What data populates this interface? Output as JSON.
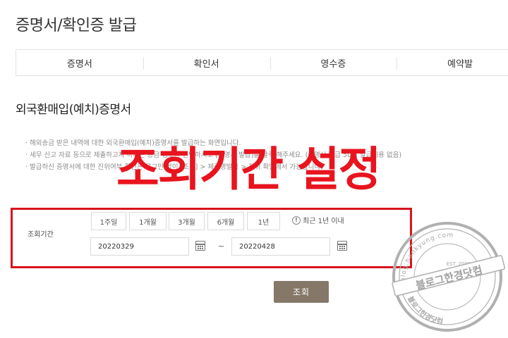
{
  "page_title": "증명서/확인증 발급",
  "tabs": [
    {
      "label": "증명서"
    },
    {
      "label": "확인서"
    },
    {
      "label": "영수증"
    },
    {
      "label": "예약발"
    }
  ],
  "section_title": "외국환매입(예치)증명서",
  "notes": [
    "· 해외송금 받은 내역에 대한 외국환매입(예치)증명서를 발급하는 화면입니다.",
    "· 세무 신고 자료 등으로 제출하고자 하시는 송금 정보를 선택하시고 [증명서 발급]을 클릭 해주세요. (증명서 발급 50매 발급비용 없음)",
    "· 발급하신 증명서에 대한 진위여부 확인은 로그인 없이 [조회] > 제증명발급 > 진위 확인에서 가능합니다."
  ],
  "overlay_caption": "조회기간 설정",
  "search_period": {
    "label": "조회기간",
    "buttons": [
      "1주일",
      "1개월",
      "3개월",
      "6개월",
      "1년"
    ],
    "note": "최근 1년 이내",
    "from": "20220329",
    "to": "20220428",
    "separator": "~"
  },
  "search_button": "조회",
  "watermark": {
    "main": "블로그한경닷컴",
    "top": "blog.hankyung.com",
    "year": "EST. 2009",
    "bottom": "블로그한경닷컴"
  },
  "colors": {
    "highlight_red": "#d8141c",
    "overlay_red": "#e8141e",
    "button_brown": "#857868"
  }
}
